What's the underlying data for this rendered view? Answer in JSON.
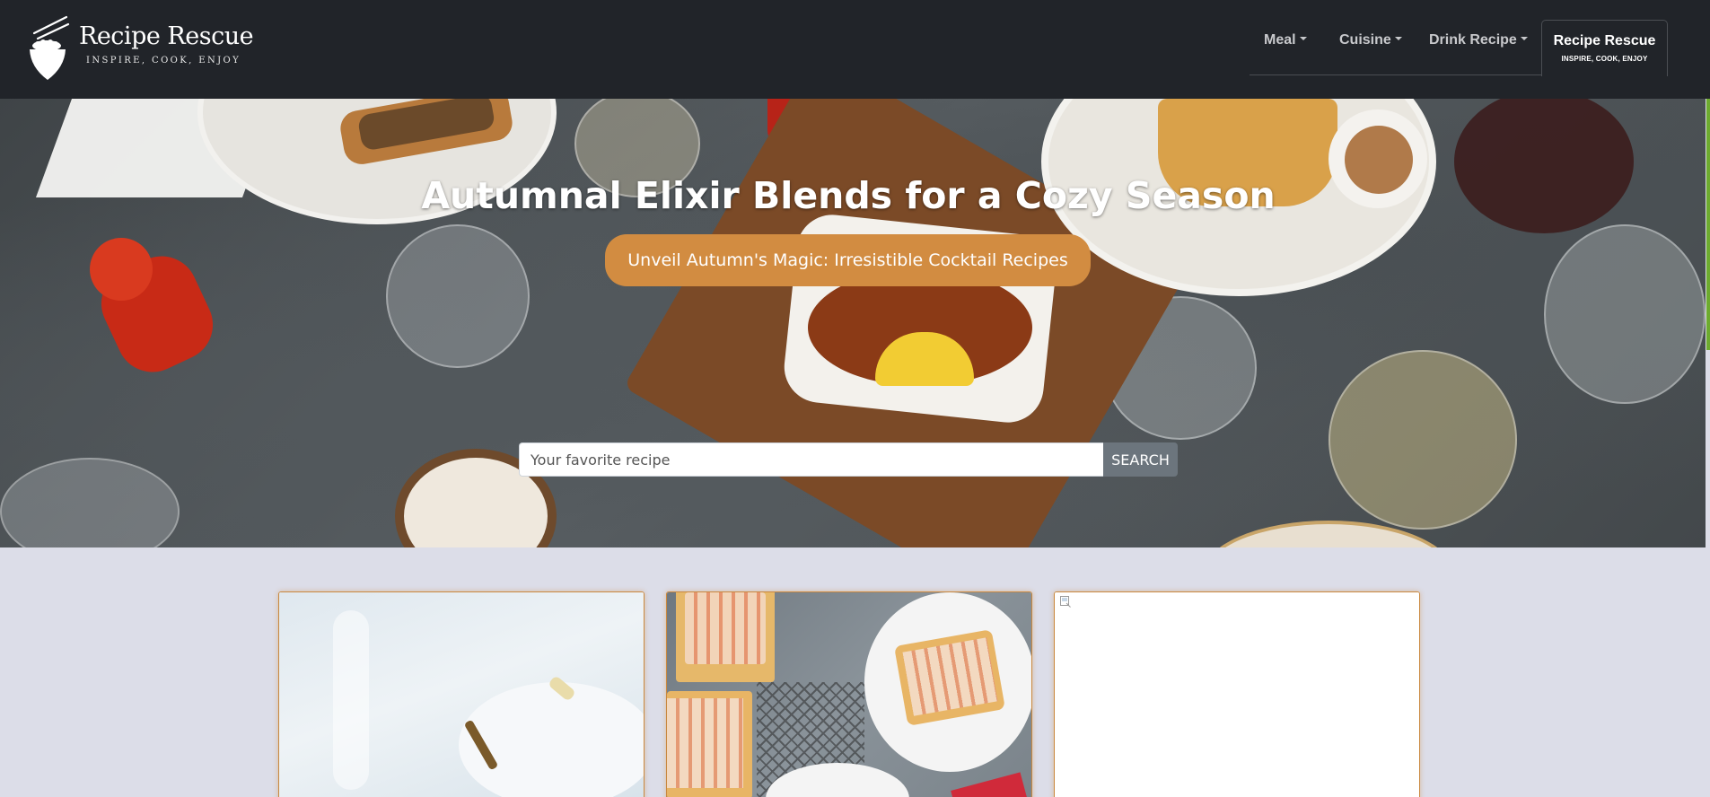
{
  "brand": {
    "name": "Recipe Rescue",
    "tagline": "INSPIRE, COOK, ENJOY"
  },
  "nav": {
    "items": [
      {
        "label": "Meal"
      },
      {
        "label": "Cuisine"
      },
      {
        "label": "Drink Recipe"
      }
    ],
    "active": {
      "title": "Recipe Rescue",
      "subtitle": "INSPIRE, COOK, ENJOY"
    }
  },
  "hero": {
    "title": "Autumnal Elixir Blends for a Cozy Season",
    "button_label": "Unveil Autumn's Magic: Irresistible Cocktail Recipes"
  },
  "search": {
    "placeholder": "Your favorite recipe",
    "button_label": "SEARCH"
  },
  "cards": [
    {
      "image": "pear-dessert-photo"
    },
    {
      "image": "apple-tart-photo"
    },
    {
      "image": "broken-image-icon"
    }
  ],
  "colors": {
    "navbar_bg": "#212429",
    "accent_orange": "#d28c41",
    "page_bg": "#dcdde8",
    "search_button": "#6c757d"
  }
}
